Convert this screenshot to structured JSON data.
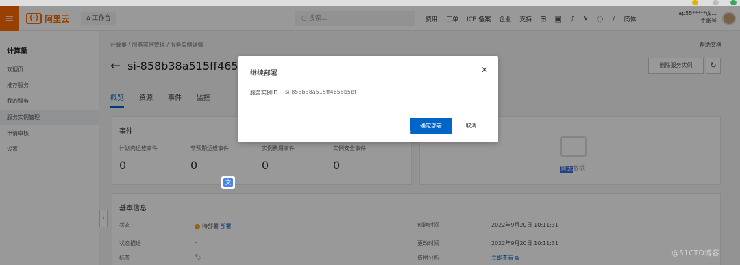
{
  "colors": {
    "brand": "#ff6a00",
    "primary": "#0064c8",
    "warning": "#f5a623"
  },
  "topbar": {
    "menu_icon": "hamburger-icon",
    "logo_text": "阿里云",
    "logo_mark": "(-)",
    "workbench_label": "工作台",
    "search_placeholder": "搜索...",
    "links": [
      "费用",
      "工单",
      "ICP 备案",
      "企业",
      "支持"
    ],
    "lang": "简体",
    "account_name": "ap55*****@...",
    "account_type": "主账号"
  },
  "sidebar": {
    "title": "计算巢",
    "items": [
      "欢迎页",
      "推荐服务",
      "我的服务",
      "服务实例管理",
      "申请审核",
      "设置"
    ],
    "active_index": 3
  },
  "main": {
    "breadcrumb": [
      "计算巢",
      "服务实例管理",
      "服务实例详情"
    ],
    "docs_link": "帮助文档",
    "title": "si-858b38a515ff465",
    "release_button": "删除服务实例",
    "tabs": [
      "概览",
      "资源",
      "事件",
      "监控"
    ],
    "active_tab": 0,
    "events": {
      "title": "事件",
      "stats": [
        {
          "label": "计划内运维事件",
          "value": "0"
        },
        {
          "label": "非预期运维事件",
          "value": "0"
        },
        {
          "label": "实例费用事件",
          "value": "0"
        },
        {
          "label": "实例安全事件",
          "value": "0"
        }
      ]
    },
    "empty": {
      "highlight": "暂无",
      "rest": "数据"
    },
    "basic_info": {
      "title": "基本信息",
      "status_label": "状态",
      "status_value": "待部署",
      "deploy_link": "部署",
      "status_desc_label": "状态描述",
      "status_desc_value": "-",
      "tags_label": "标签",
      "created_label": "创建时间",
      "created_value": "2022年9月20日 10:11:31",
      "updated_label": "更改时间",
      "updated_value": "2022年9月20日 10:11:31",
      "cost_label": "费用分析",
      "cost_link": "立即查看"
    }
  },
  "modal": {
    "title": "继续部署",
    "id_label": "服务实例ID",
    "id_value": "si-858b38a515ff4658b5bf",
    "confirm": "确定部署",
    "cancel": "取消"
  },
  "watermark": "@51CTO博客"
}
